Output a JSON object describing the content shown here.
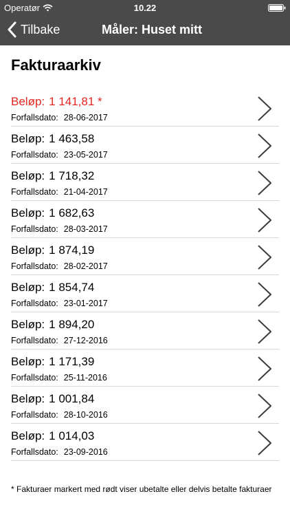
{
  "status_bar": {
    "carrier": "Operatør",
    "time": "10.22",
    "icons": [
      "wifi-icon",
      "battery-icon"
    ]
  },
  "nav": {
    "back_label": "Tilbake",
    "title": "Måler: Huset mitt",
    "back_icon": "chevron-left-icon"
  },
  "page": {
    "heading": "Fakturaarkiv"
  },
  "invoices": {
    "amount_label": "Beløp:",
    "date_label": "Forfallsdato:",
    "items": [
      {
        "amount": "1 141,81 *",
        "due_date": "28-06-2017",
        "unpaid": true
      },
      {
        "amount": "1 463,58",
        "due_date": "23-05-2017",
        "unpaid": false
      },
      {
        "amount": "1 718,32",
        "due_date": "21-04-2017",
        "unpaid": false
      },
      {
        "amount": "1 682,63",
        "due_date": "28-03-2017",
        "unpaid": false
      },
      {
        "amount": "1 874,19",
        "due_date": "28-02-2017",
        "unpaid": false
      },
      {
        "amount": "1 854,74",
        "due_date": "23-01-2017",
        "unpaid": false
      },
      {
        "amount": "1 894,20",
        "due_date": "27-12-2016",
        "unpaid": false
      },
      {
        "amount": "1 171,39",
        "due_date": "25-11-2016",
        "unpaid": false
      },
      {
        "amount": "1 001,84",
        "due_date": "28-10-2016",
        "unpaid": false
      },
      {
        "amount": "1 014,03",
        "due_date": "23-09-2016",
        "unpaid": false
      }
    ]
  },
  "footnote": "* Fakturaer markert med rødt viser ubetalte eller delvis betalte fakturaer",
  "colors": {
    "bar_background": "#4a4a4a",
    "unpaid_text": "#e3261f",
    "separator": "#d6d6d6"
  }
}
